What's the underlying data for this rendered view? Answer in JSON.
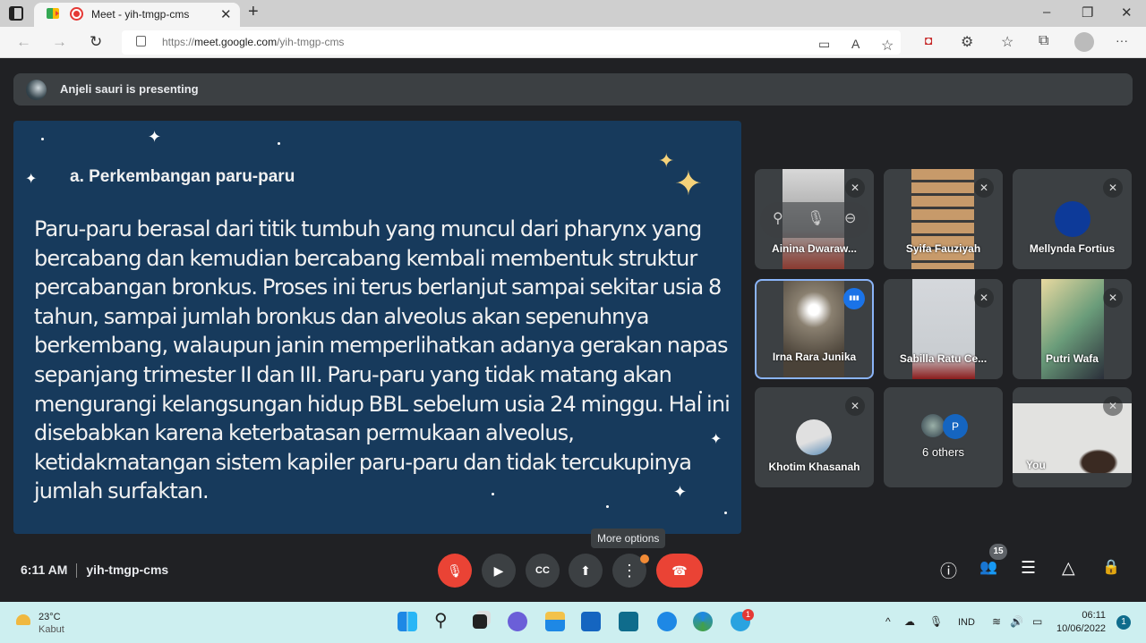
{
  "browser": {
    "tab_title": "Meet - yih-tmgp-cms",
    "tab_close": "✕",
    "new_tab": "+",
    "url_prefix": "https://",
    "url_host": "meet.google.com",
    "url_path": "/yih-tmgp-cms",
    "window_controls": {
      "minimize": "–",
      "maximize": "❐",
      "close": "✕"
    },
    "nav": {
      "back": "←",
      "forward": "→",
      "reload": "↻"
    },
    "toolbar_icons": [
      "camera-icon",
      "read-aloud-icon",
      "add-favorite-icon",
      "extension-shield-icon",
      "extensions-icon",
      "favorites-icon",
      "collections-icon",
      "profile-icon",
      "more-icon"
    ],
    "toolbar_glyphs": {
      "camera": "▭",
      "read_aloud": "A",
      "favorite": "☆",
      "ext": "◘",
      "puzzle": "⚙",
      "favorites": "☆",
      "collections": "⧉",
      "more": "···"
    }
  },
  "meet": {
    "presenting_text": "Anjeli sauri is presenting",
    "slide": {
      "heading": "a. Perkembangan paru-paru",
      "body": "Paru-paru berasal dari titik tumbuh yang muncul dari pharynx yang bercabang dan kemudian bercabang kembali membentuk struktur percabangan bronkus. Proses ini terus berlanjut sampai sekitar usia 8 tahun, sampai jumlah bronkus dan alveolus akan sepenuhnya berkembang, walaupun janin memperlihatkan adanya gerakan napas sepanjang trimester II dan III. Paru-paru yang tidak matang akan mengurangi kelangsungan hidup BBL sebelum usia 24 minggu. Hal ini disebabkan karena keterbatasan permukaan alveolus, ketidakmatangan sistem kapiler paru-paru dan tidak tercukupinya jumlah surfaktan."
    },
    "participants": [
      {
        "name": "Ainina Dwaraw...",
        "muted": true,
        "video": true
      },
      {
        "name": "Syifa Fauziyah",
        "muted": true,
        "video": true
      },
      {
        "name": "Mellynda Fortius",
        "muted": true,
        "video": false
      },
      {
        "name": "Irna Rara Junika",
        "muted": false,
        "speaking": true,
        "video": true
      },
      {
        "name": "Sabilla Ratu Ce...",
        "muted": true,
        "video": true
      },
      {
        "name": "Putri Wafa",
        "muted": true,
        "video": true
      },
      {
        "name": "Khotim Khasanah",
        "muted": true,
        "video": false
      },
      {
        "name": "6 others",
        "avatar_letter": "P"
      },
      {
        "name": "You",
        "muted": true,
        "video": true
      }
    ],
    "hover_controls": {
      "pin": "⚲",
      "mute": "🎙",
      "remove": "⊖"
    },
    "mute_glyph": "✕",
    "speaking_glyph": "▮▮▮",
    "bottom": {
      "time": "6:11 AM",
      "meeting_code": "yih-tmgp-cms",
      "tooltip": "More options",
      "participant_count": "15",
      "controls": {
        "mic": "🎙",
        "camera": "▶",
        "captions": "CC",
        "present": "⬆",
        "more": "⋮",
        "end": "☎"
      },
      "right_glyphs": {
        "info": "ⓘ",
        "people": "👥",
        "chat": "☰",
        "activities": "△",
        "host": "🔒"
      }
    },
    "colors": {
      "accent_blue": "#1a73e8",
      "end_red": "#ea4335",
      "slide_bg": "#173a5c",
      "notif_orange": "#f28b36"
    }
  },
  "taskbar": {
    "weather_temp": "23°C",
    "weather_desc": "Kabut",
    "search_glyph": "⚲",
    "language": "IND",
    "time": "06:11",
    "date": "10/06/2022",
    "notifications": "1",
    "telegram_badge": "1",
    "tray_glyphs": {
      "chevron": "^",
      "cloud": "☁",
      "mic": "🎙",
      "wifi": "≋",
      "volume": "🔊",
      "battery": "▭"
    }
  }
}
